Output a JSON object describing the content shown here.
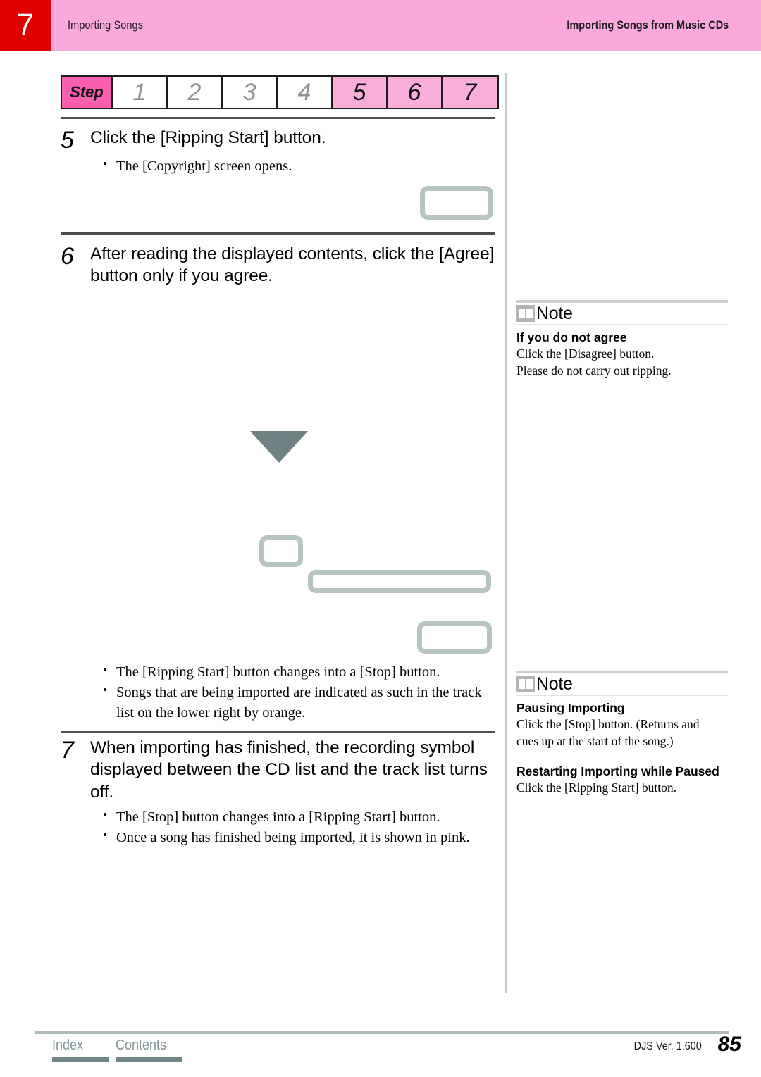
{
  "header": {
    "chapter_number": "7",
    "left_title": "Importing Songs",
    "right_title": "Importing Songs from Music CDs"
  },
  "step_strip": {
    "label": "Step",
    "cells": [
      {
        "number": "1",
        "state": "inactive"
      },
      {
        "number": "2",
        "state": "inactive"
      },
      {
        "number": "3",
        "state": "inactive"
      },
      {
        "number": "4",
        "state": "inactive"
      },
      {
        "number": "5",
        "state": "active"
      },
      {
        "number": "6",
        "state": "active"
      },
      {
        "number": "7",
        "state": "active"
      }
    ]
  },
  "steps": [
    {
      "number": "5",
      "title": "Click the [Ripping Start] button.",
      "bullets": [
        "The [Copyright]  screen opens."
      ]
    },
    {
      "number": "6",
      "title": "After reading the displayed contents, click the [Agree] button only if you agree.",
      "bullets": []
    },
    {
      "number": "7",
      "title": "When importing has finished, the recording symbol displayed between the CD list and the track list turns off.",
      "bullets": [
        "The [Stop] button changes into a [Ripping Start]  button.",
        "Once a song has finished being imported, it is shown in pink."
      ]
    }
  ],
  "mid_bullets": [
    "The [Ripping Start] button changes into a [Stop] button.",
    "Songs that are being imported are indicated as such in the track list on the lower right by orange."
  ],
  "notes": [
    {
      "title": "Note",
      "icon": "open-book-icon",
      "sections": [
        {
          "heading": "If you do not agree",
          "lines": [
            "Click the [Disagree] button.",
            "Please do not carry out ripping."
          ]
        }
      ]
    },
    {
      "title": "Note",
      "icon": "open-book-icon",
      "sections": [
        {
          "heading": "Pausing Importing",
          "lines": [
            "Click the [Stop] button. (Returns and",
            "cues up at the start of the song.)"
          ]
        },
        {
          "heading": "Restarting Importing while Paused",
          "lines": [
            "Click the [Ripping Start] button."
          ]
        }
      ]
    }
  ],
  "footer": {
    "index_label": "Index",
    "contents_label": "Contents",
    "version": "DJS Ver.  1.600",
    "page_number": "85"
  },
  "colors": {
    "header_pink": "#fba9da",
    "chapter_red": "#e10000",
    "step_label_pink": "#fa5fae",
    "step_active_pink": "#f8aed8",
    "placeholder_gray": "#b7c4c4",
    "arrow_gray": "#6e8284",
    "footer_link": "#7f9596"
  }
}
